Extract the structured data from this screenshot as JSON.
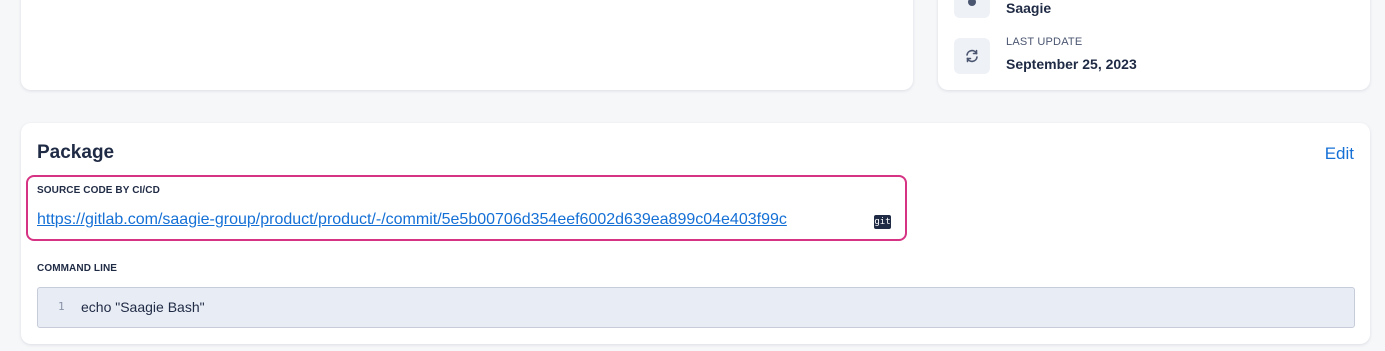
{
  "metadata": {
    "owner_value": "Saagie",
    "last_update_label": "LAST UPDATE",
    "last_update_value": "September 25, 2023"
  },
  "package": {
    "title": "Package",
    "edit_label": "Edit",
    "source_label": "SOURCE CODE BY CI/CD",
    "source_url": "https://gitlab.com/saagie-group/product/product/-/commit/5e5b00706d354eef6002d639ea899c04e403f99c",
    "git_badge": "git",
    "command_label": "COMMAND LINE",
    "command_lines": [
      {
        "number": "1",
        "text": "echo \"Saagie Bash\""
      }
    ]
  },
  "colors": {
    "accent_link": "#1570d6",
    "highlight_border": "#d63384",
    "code_background": "#e8ecf5"
  },
  "icons": {
    "owner": "person-icon",
    "update": "refresh-icon",
    "git": "git-icon"
  }
}
